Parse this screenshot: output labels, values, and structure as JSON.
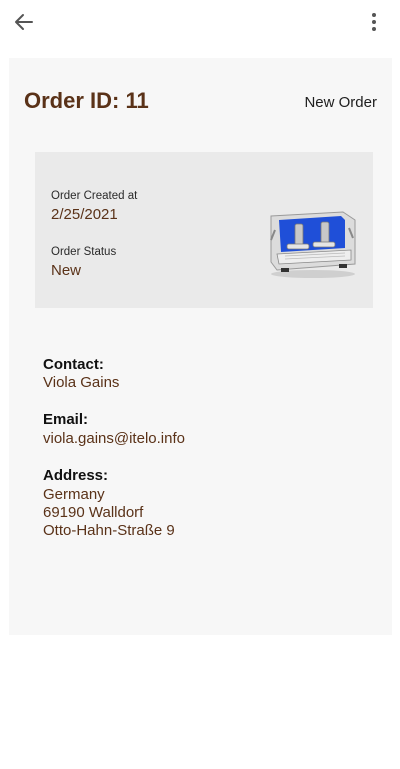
{
  "header": {
    "back_icon": "arrow-left-icon",
    "menu_icon": "more-vertical-icon"
  },
  "order": {
    "title": "Order ID: 11",
    "type": "New Order"
  },
  "status_panel": {
    "created_label": "Order Created at",
    "created_value": "2/25/2021",
    "status_label": "Order Status",
    "status_value": "New",
    "image_icon": "espresso-machine-icon",
    "accent_color": "#1f4fd8"
  },
  "details": {
    "contact_label": "Contact:",
    "contact_value": "Viola Gains",
    "email_label": "Email:",
    "email_value": "viola.gains@itelo.info",
    "address_label": "Address:",
    "address_country": "Germany",
    "address_city": "69190 Walldorf",
    "address_street": "Otto-Hahn-Straße 9"
  },
  "colors": {
    "title": "#5a3218",
    "value": "#5a3218",
    "card_bg": "#f7f7f7",
    "panel_bg": "#eaeaea"
  }
}
